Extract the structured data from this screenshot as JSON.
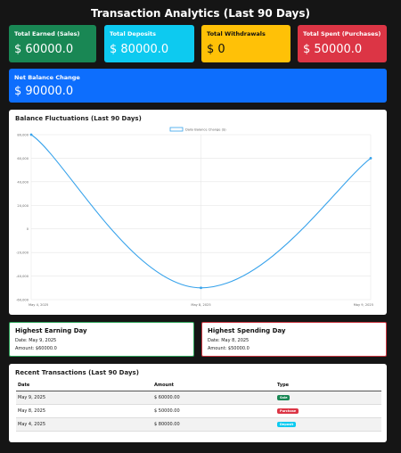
{
  "page": {
    "title": "Transaction Analytics (Last 90 Days)"
  },
  "summary": {
    "earned": {
      "label": "Total Earned (Sales)",
      "value": "$ 60000.0"
    },
    "deposits": {
      "label": "Total Deposits",
      "value": "$ 80000.0"
    },
    "withdrawals": {
      "label": "Total Withdrawals",
      "value": "$ 0"
    },
    "spent": {
      "label": "Total Spent (Purchases)",
      "value": "$ 50000.0"
    },
    "net": {
      "label": "Net Balance Change",
      "value": "$ 90000.0"
    }
  },
  "colors": {
    "green": "#198754",
    "cyan": "#0dcaf0",
    "yellow": "#ffc107",
    "red": "#dc3545",
    "blue": "#0d6efd",
    "line": "#36a2eb"
  },
  "chart_panel": {
    "title": "Balance Fluctuations (Last 90 Days)"
  },
  "chart_data": {
    "type": "line",
    "title": "",
    "legend_position": "top",
    "grid": true,
    "x": [
      "May 4, 2025",
      "May 8, 2025",
      "May 9, 2025"
    ],
    "series": [
      {
        "name": "Daily Balance Change ($)",
        "values": [
          80000,
          -50000,
          60000
        ]
      }
    ],
    "ylim": [
      -60000,
      80000
    ],
    "yticks": [
      80000,
      60000,
      40000,
      20000,
      0,
      -20000,
      -40000,
      -60000
    ],
    "ytick_labels": [
      "80,000",
      "60,000",
      "40,000",
      "20,000",
      "0",
      "-20,000",
      "-40,000",
      "-60,000"
    ]
  },
  "highlights": {
    "earning": {
      "title": "Highest Earning Day",
      "date": "Date: May 9, 2025",
      "amount": "Amount: $60000.0"
    },
    "spending": {
      "title": "Highest Spending Day",
      "date": "Date: May 8, 2025",
      "amount": "Amount: $50000.0"
    }
  },
  "transactions": {
    "title": "Recent Transactions (Last 90 Days)",
    "headers": [
      "Date",
      "Amount",
      "Type"
    ],
    "rows": [
      {
        "date": "May 9, 2025",
        "amount": "$ 60000.00",
        "type": "Sale",
        "color": "#198754"
      },
      {
        "date": "May 8, 2025",
        "amount": "$ 50000.00",
        "type": "Purchase",
        "color": "#dc3545"
      },
      {
        "date": "May 4, 2025",
        "amount": "$ 80000.00",
        "type": "Deposit",
        "color": "#0dcaf0"
      }
    ]
  }
}
